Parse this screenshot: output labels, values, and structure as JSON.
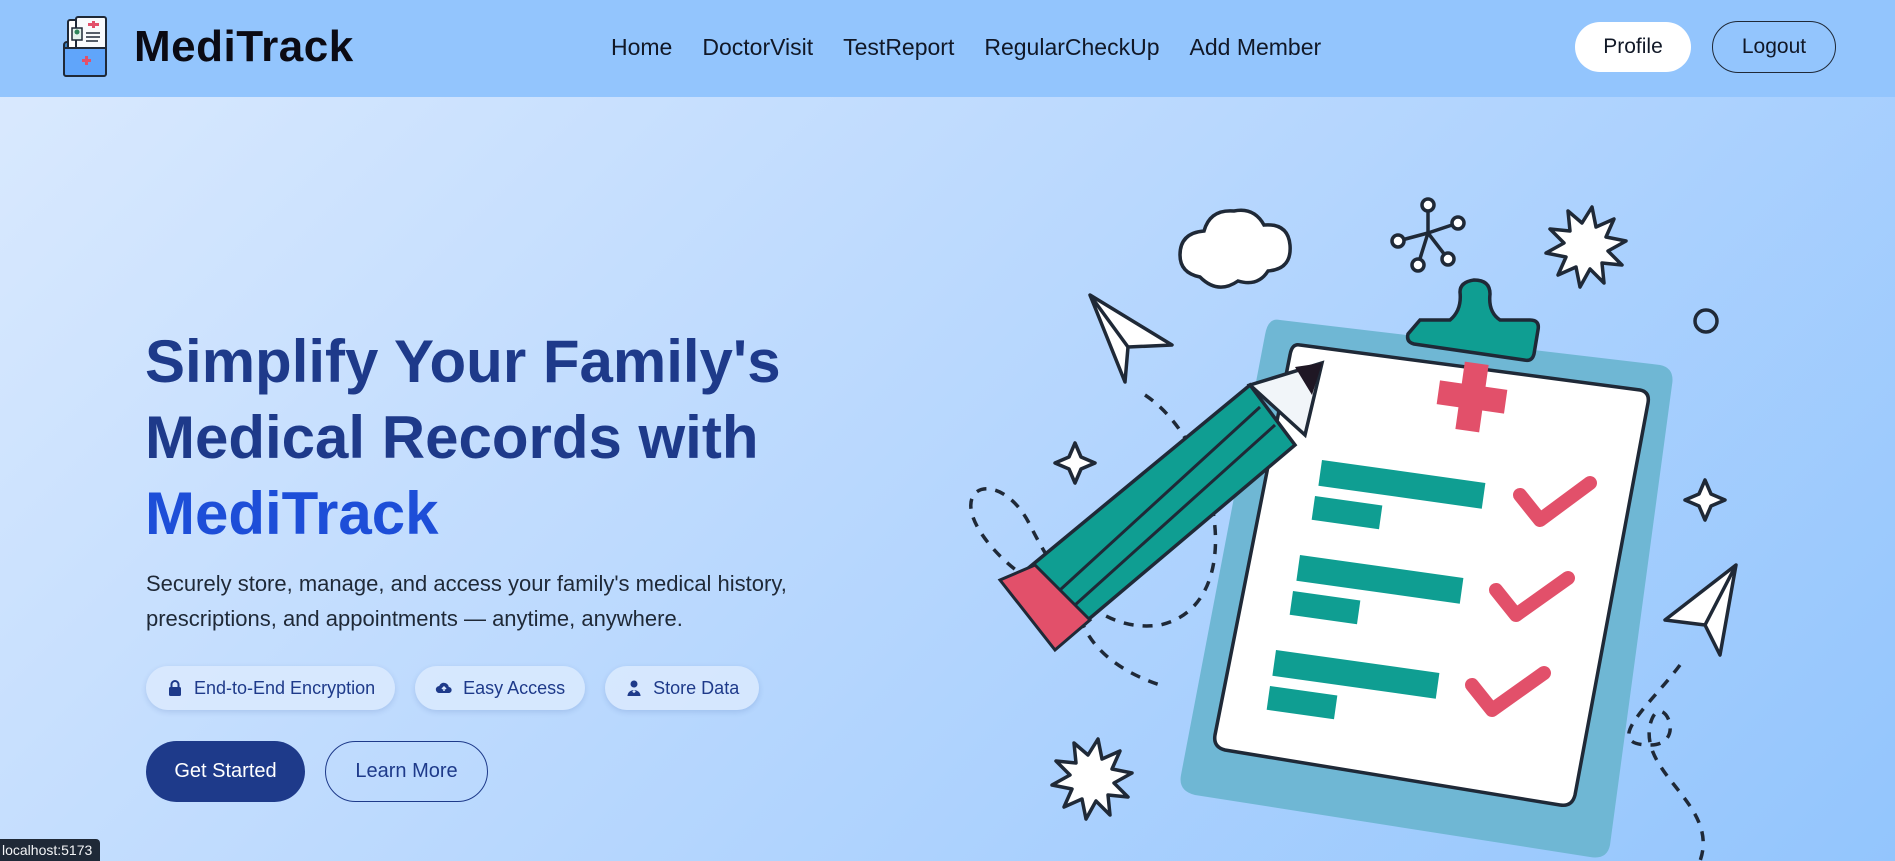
{
  "brand": {
    "name": "MediTrack"
  },
  "nav": {
    "links": [
      "Home",
      "DoctorVisit",
      "TestReport",
      "RegularCheckUp",
      "Add Member"
    ],
    "profile_label": "Profile",
    "logout_label": "Logout"
  },
  "hero": {
    "title_line1": "Simplify Your Family's",
    "title_line2": "Medical Records with",
    "title_accent": "MediTrack",
    "subtitle": "Securely store, manage, and access your family's medical history, prescriptions, and appointments — anytime, anywhere.",
    "badges": [
      {
        "label": "End-to-End Encryption",
        "icon": "lock-icon"
      },
      {
        "label": "Easy Access",
        "icon": "cloud-upload-icon"
      },
      {
        "label": "Store Data",
        "icon": "user-doctor-icon"
      }
    ],
    "get_started_label": "Get Started",
    "learn_more_label": "Learn More"
  },
  "status_bar": {
    "url": "localhost:5173"
  },
  "colors": {
    "navbar": "#93c5fd",
    "primary": "#1e3a8a",
    "accent": "#1d4ed8",
    "teal": "#0f9e92",
    "red": "#e2506a"
  }
}
